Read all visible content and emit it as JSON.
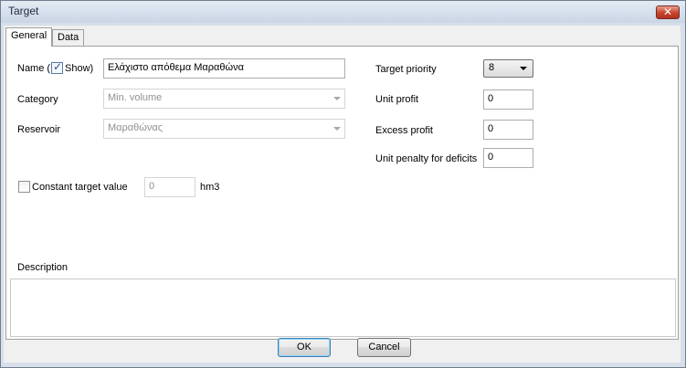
{
  "window": {
    "title": "Target",
    "close_glyph": "✕"
  },
  "tabs": [
    {
      "label": "General",
      "active": true
    },
    {
      "label": "Data",
      "active": false
    }
  ],
  "general": {
    "name_label_prefix": "Name (",
    "show_label": "Show)",
    "show_checked": true,
    "name_value": "Ελάχιστο απόθεμα Μαραθώνα",
    "category_label": "Category",
    "category_value": "Min. volume",
    "reservoir_label": "Reservoir",
    "reservoir_value": "Μαραθώνας",
    "constant_label": "Constant target value",
    "constant_checked": false,
    "constant_value": "0",
    "constant_unit": "hm3",
    "target_priority_label": "Target priority",
    "target_priority_value": "8",
    "unit_profit_label": "Unit profit",
    "unit_profit_value": "0",
    "excess_profit_label": "Excess profit",
    "excess_profit_value": "0",
    "unit_penalty_label": "Unit penalty for deficits",
    "unit_penalty_value": "0",
    "description_label": "Description",
    "description_value": ""
  },
  "buttons": {
    "ok": "OK",
    "cancel": "Cancel"
  },
  "icons": {
    "check": "checkmark-icon",
    "close": "close-icon",
    "dropdown": "chevron-down-icon"
  }
}
